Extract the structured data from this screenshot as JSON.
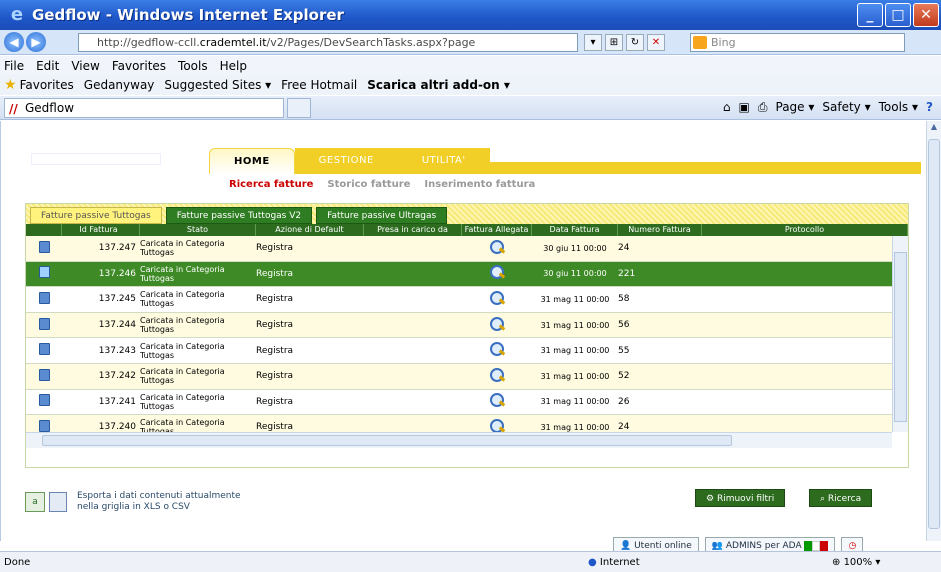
{
  "window": {
    "title": "Gedflow - Windows Internet Explorer",
    "min": "_",
    "max": "□",
    "close": "✕"
  },
  "address": {
    "url_prefix": "http://gedflow-ccll.",
    "url_domain": "crademtel.it",
    "url_rest": "/v2/Pages/DevSearchTasks.aspx?page",
    "search_placeholder": "Bing"
  },
  "menu": [
    "File",
    "Edit",
    "View",
    "Favorites",
    "Tools",
    "Help"
  ],
  "favorites": {
    "label": "Favorites",
    "items": [
      "Gedanyway",
      "Suggested Sites ▾",
      "Free Hotmail",
      "Scarica altri add-on ▾"
    ]
  },
  "cmdbar": {
    "tab_title": "Gedflow",
    "page": "Page ▾",
    "safety": "Safety ▾",
    "tools": "Tools ▾"
  },
  "main_tabs": [
    {
      "label": "HOME",
      "active": true
    },
    {
      "label": "GESTIONE",
      "active": false
    },
    {
      "label": "UTILITA'",
      "active": false
    }
  ],
  "subnav": [
    "Ricerca fatture",
    "Storico fatture",
    "Inserimento fattura"
  ],
  "grid_tabs": [
    "Fatture passive Tuttogas",
    "Fatture passive Tuttogas V2",
    "Fatture passive Ultragas"
  ],
  "columns": [
    "",
    "Id Fattura",
    "Stato",
    "Azione di Default",
    "Presa in carico da",
    "Fattura Allegata",
    "Data Fattura",
    "Numero Fattura",
    "Protocollo"
  ],
  "rows": [
    {
      "id": "137.247",
      "stato": "Caricata in Categoria Tuttogas",
      "azione": "Registra",
      "presa": "",
      "data": "30 giu 11 00:00",
      "numero": "24",
      "protocollo": "",
      "style": "even"
    },
    {
      "id": "137.246",
      "stato": "Caricata in Categoria Tuttogas",
      "azione": "Registra",
      "presa": "",
      "data": "30 giu 11 00:00",
      "numero": "221",
      "protocollo": "",
      "style": "sel"
    },
    {
      "id": "137.245",
      "stato": "Caricata in Categoria Tuttogas",
      "azione": "Registra",
      "presa": "",
      "data": "31 mag 11 00:00",
      "numero": "58",
      "protocollo": "",
      "style": "odd"
    },
    {
      "id": "137.244",
      "stato": "Caricata in Categoria Tuttogas",
      "azione": "Registra",
      "presa": "",
      "data": "31 mag 11 00:00",
      "numero": "56",
      "protocollo": "",
      "style": "even"
    },
    {
      "id": "137.243",
      "stato": "Caricata in Categoria Tuttogas",
      "azione": "Registra",
      "presa": "",
      "data": "31 mag 11 00:00",
      "numero": "55",
      "protocollo": "",
      "style": "odd"
    },
    {
      "id": "137.242",
      "stato": "Caricata in Categoria Tuttogas",
      "azione": "Registra",
      "presa": "",
      "data": "31 mag 11 00:00",
      "numero": "52",
      "protocollo": "",
      "style": "even"
    },
    {
      "id": "137.241",
      "stato": "Caricata in Categoria Tuttogas",
      "azione": "Registra",
      "presa": "",
      "data": "31 mag 11 00:00",
      "numero": "26",
      "protocollo": "",
      "style": "odd"
    },
    {
      "id": "137.240",
      "stato": "Caricata in Categoria Tuttogas",
      "azione": "Registra",
      "presa": "",
      "data": "31 mag 11 00:00",
      "numero": "24",
      "protocollo": "",
      "style": "even"
    }
  ],
  "export": {
    "line1": "Esporta i dati contenuti attualmente",
    "line2": "nella griglia in XLS o CSV"
  },
  "buttons": {
    "rimuovi": "Rimuovi filtri",
    "ricerca": "Ricerca"
  },
  "footer": {
    "utenti": "Utenti online",
    "admins": "ADMINS per ADA"
  },
  "status": {
    "left": "Done",
    "zone": "Internet",
    "zoom": "100%"
  },
  "colors": {
    "accent_green": "#2d6b1f",
    "tab_yellow": "#f1cf26",
    "active_red": "#cc0000"
  }
}
